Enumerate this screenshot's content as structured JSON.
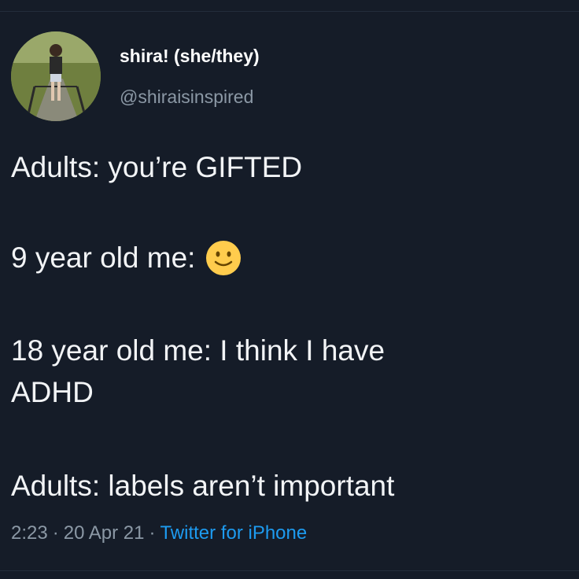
{
  "author": {
    "display_name": "shira! (she/they)",
    "handle": "@shiraisinspired",
    "avatar_icon": "profile-photo"
  },
  "tweet": {
    "lines": [
      "Adults: you’re GIFTED",
      "9 year old me:",
      "18 year old me: I think I have",
      "ADHD",
      "Adults: labels aren’t important"
    ],
    "emoji_icon": "slightly-smiling-face"
  },
  "meta": {
    "time": "2:23",
    "date": "20 Apr 21",
    "separator": "·",
    "source": "Twitter for iPhone"
  },
  "colors": {
    "background": "#151c28",
    "text": "#f2f4f6",
    "secondary_text": "#8b98a5",
    "link": "#1d9bf0"
  }
}
